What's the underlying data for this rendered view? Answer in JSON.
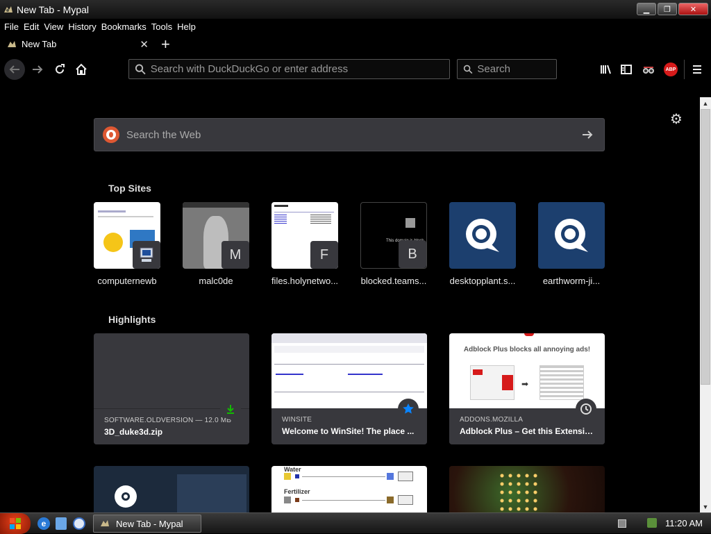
{
  "window": {
    "title": "New Tab - Mypal",
    "minimize": "▁",
    "maximize": "❐",
    "close": "✕"
  },
  "menu": [
    "File",
    "Edit",
    "View",
    "History",
    "Bookmarks",
    "Tools",
    "Help"
  ],
  "tab": {
    "label": "New Tab",
    "close": "✕",
    "new": "+"
  },
  "navbar": {
    "url_placeholder": "Search with DuckDuckGo or enter address",
    "search_placeholder": "Search",
    "abp_label": "ABP"
  },
  "newtab": {
    "web_search_placeholder": "Search the Web",
    "top_sites_title": "Top Sites",
    "top_sites": [
      {
        "label": "computernewb",
        "badge": ""
      },
      {
        "label": "malc0de",
        "badge": "M"
      },
      {
        "label": "files.holynetwo...",
        "badge": "F"
      },
      {
        "label": "blocked.teams...",
        "badge": "B"
      },
      {
        "label": "desktopplant.s...",
        "badge": ""
      },
      {
        "label": "earthworm-ji...",
        "badge": ""
      }
    ],
    "highlights_title": "Highlights",
    "highlights": [
      {
        "source": "SOFTWARE.OLDVERSION — 12.0 MB",
        "title": "3D_duke3d.zip",
        "icon": "download-icon"
      },
      {
        "source": "WINSITE",
        "title": "Welcome to WinSite! The place ...",
        "icon": "bookmark-star-icon"
      },
      {
        "source": "ADDONS.MOZILLA",
        "title": "Adblock Plus – Get this Extensio...",
        "icon": "history-clock-icon"
      }
    ],
    "adblock_banner": "Adblock Plus blocks all annoying ads!",
    "water_label": "Water",
    "fertilizer_label": "Fertilizer",
    "blocked_text": "This domain is block"
  },
  "taskbar": {
    "task_label": "New Tab - Mypal",
    "clock": "11:20 AM"
  },
  "colors": {
    "panel": "#38383d",
    "accent_blue": "#0a84ff",
    "download_green": "#12bc00",
    "site_blue": "#1c3f6e"
  }
}
